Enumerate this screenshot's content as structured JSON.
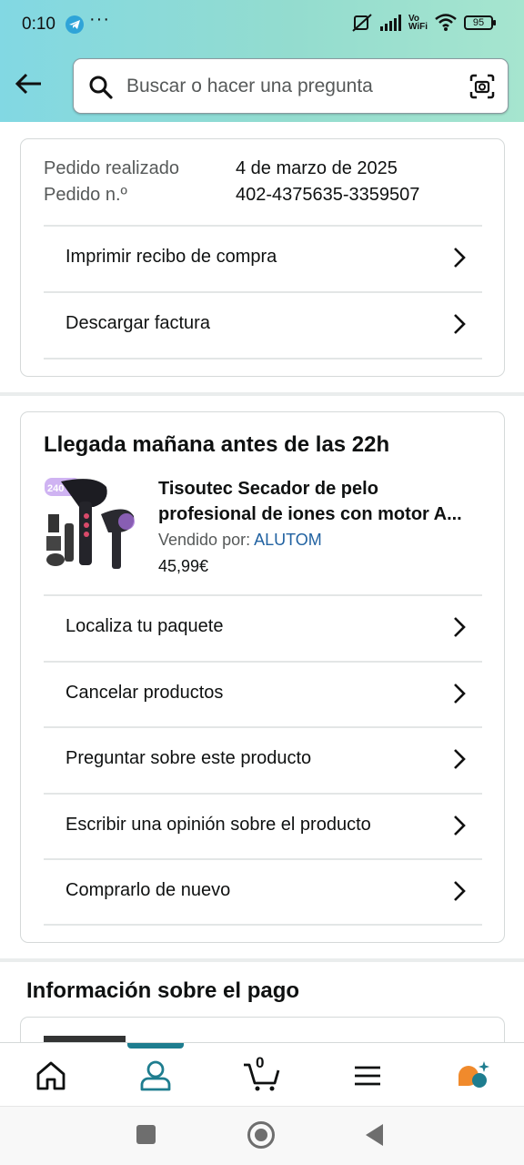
{
  "status_bar": {
    "time": "0:10",
    "notification_icons": [
      "telegram-icon",
      "more-dots-icon"
    ],
    "more": "···",
    "vowifi_top": "Vo",
    "vowifi_bottom": "WiFi",
    "battery": "95"
  },
  "header": {
    "search_placeholder": "Buscar o hacer una pregunta"
  },
  "order_summary": {
    "date_label": "Pedido realizado",
    "date_value": "4 de marzo de 2025",
    "number_label": "Pedido n.º",
    "number_value": "402-4375635-3359507",
    "actions": [
      {
        "label": "Imprimir recibo de compra"
      },
      {
        "label": "Descargar factura"
      }
    ]
  },
  "shipment": {
    "title": "Llegada mañana antes de las 22h",
    "product": {
      "name_line1": "Tisoutec Secador de pelo",
      "name_line2": "profesional de iones con motor A...",
      "sold_by_label": "Vendido por:",
      "seller": "ALUTOM",
      "price": "45,99€"
    },
    "actions": [
      {
        "label": "Localiza tu paquete"
      },
      {
        "label": "Cancelar productos"
      },
      {
        "label": "Preguntar sobre este producto"
      },
      {
        "label": "Escribir una opinión sobre el producto"
      },
      {
        "label": "Comprarlo de nuevo"
      }
    ]
  },
  "payment": {
    "title": "Información sobre el pago"
  },
  "bottom_nav": {
    "items": [
      "home-icon",
      "account-icon",
      "cart-icon",
      "menu-icon",
      "rufus-icon"
    ],
    "cart_count": "0",
    "active": "account-icon",
    "accent_color": "#1e7d8f"
  },
  "colors": {
    "header_gradient_start": "#82d8e3",
    "header_gradient_end": "#a6e5cf",
    "link": "#2162a1",
    "text": "#0f1111"
  }
}
